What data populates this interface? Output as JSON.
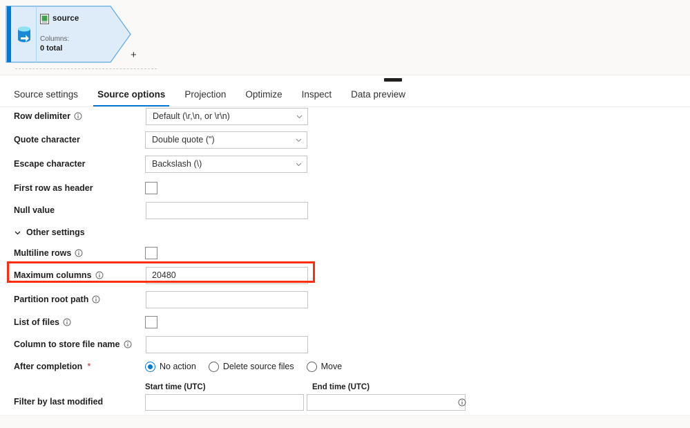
{
  "canvas": {
    "node": {
      "title": "source",
      "columns_label": "Columns:",
      "columns_value": "0 total",
      "add_symbol": "+",
      "source_icon": "database-source-icon",
      "file_icon": "dataset-file-icon",
      "accent_color": "#0078d4",
      "fill_color": "#deecf9"
    }
  },
  "splitter": {
    "name": "panel-resize-handle"
  },
  "tabs": [
    {
      "label": "Source settings",
      "active": false
    },
    {
      "label": "Source options",
      "active": true
    },
    {
      "label": "Projection",
      "active": false
    },
    {
      "label": "Optimize",
      "active": false
    },
    {
      "label": "Inspect",
      "active": false
    },
    {
      "label": "Data preview",
      "active": false
    }
  ],
  "form": {
    "row_delimiter": {
      "label": "Row delimiter",
      "value": "Default (\\r,\\n, or \\r\\n)",
      "has_info": true
    },
    "quote_character": {
      "label": "Quote character",
      "value": "Double quote (\")",
      "has_info": false
    },
    "escape_character": {
      "label": "Escape character",
      "value": "Backslash (\\)",
      "has_info": false
    },
    "first_row_as_header": {
      "label": "First row as header",
      "checked": false
    },
    "null_value": {
      "label": "Null value",
      "value": "",
      "placeholder": ""
    },
    "other_settings": {
      "label": "Other settings",
      "expanded": true
    },
    "multiline_rows": {
      "label": "Multiline rows",
      "checked": false,
      "has_info": true
    },
    "maximum_columns": {
      "label": "Maximum columns",
      "value": "20480",
      "has_info": true,
      "highlighted": true,
      "highlight_color": "#ff2d10"
    },
    "partition_root_path": {
      "label": "Partition root path",
      "value": "",
      "has_info": true
    },
    "list_of_files": {
      "label": "List of files",
      "checked": false,
      "has_info": true
    },
    "column_to_store_file_name": {
      "label": "Column to store file name",
      "value": "",
      "has_info": true
    },
    "after_completion": {
      "label": "After completion",
      "required": true,
      "required_marker": "*",
      "options": [
        {
          "label": "No action",
          "selected": true
        },
        {
          "label": "Delete source files",
          "selected": false
        },
        {
          "label": "Move",
          "selected": false
        }
      ]
    },
    "filter_by_last_modified": {
      "label": "Filter by last modified",
      "start_time_label": "Start time (UTC)",
      "end_time_label": "End time (UTC)",
      "start_time_value": "",
      "end_time_value": "",
      "has_info": true
    }
  }
}
